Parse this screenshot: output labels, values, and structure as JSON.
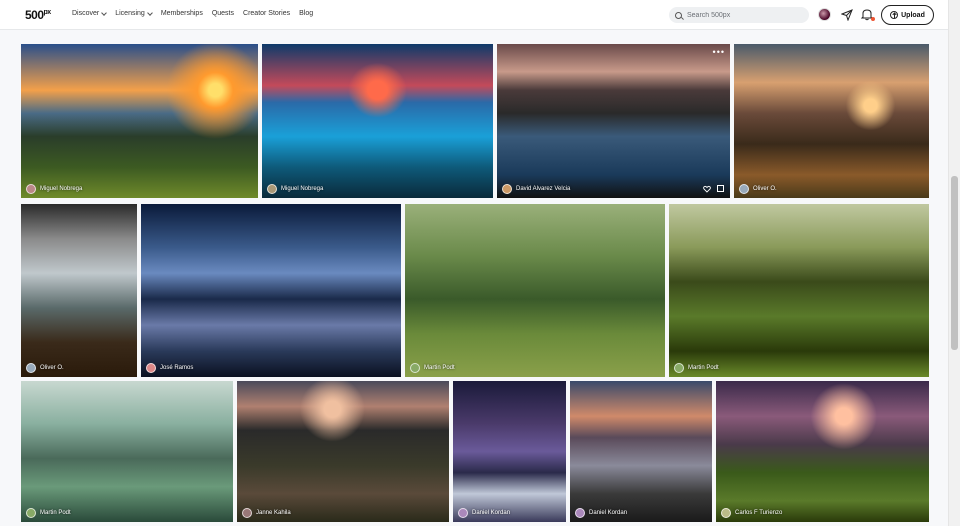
{
  "nav": {
    "logo": "500",
    "logo_sup": "px",
    "menu": [
      {
        "label": "Discover",
        "dropdown": true
      },
      {
        "label": "Licensing",
        "dropdown": true
      },
      {
        "label": "Memberships",
        "dropdown": false
      },
      {
        "label": "Quests",
        "dropdown": false
      },
      {
        "label": "Creator Stories",
        "dropdown": false
      },
      {
        "label": "Blog",
        "dropdown": false
      }
    ],
    "search_placeholder": "Search 500px",
    "upload_label": "Upload"
  },
  "photos": [
    {
      "photographer": "Miguel Nobrega",
      "scene": "cliff-sunset"
    },
    {
      "photographer": "Miguel Nobrega",
      "scene": "tidepools"
    },
    {
      "photographer": "David Alvarez Velcia",
      "scene": "sea-cliffs",
      "hovered": true
    },
    {
      "photographer": "Oliver O.",
      "scene": "coast-cliffs"
    },
    {
      "photographer": "Oliver O.",
      "scene": "fjord-vertical"
    },
    {
      "photographer": "José Ramos",
      "scene": "sea-stacks"
    },
    {
      "photographer": "Martin Podt",
      "scene": "forest-green"
    },
    {
      "photographer": "Martin Podt",
      "scene": "mossy-tree"
    },
    {
      "photographer": "Martin Podt",
      "scene": "misty-forest"
    },
    {
      "photographer": "Janne Kahila",
      "scene": "mountain-path"
    },
    {
      "photographer": "Daniel Kordan",
      "scene": "milkyway-tree"
    },
    {
      "photographer": "Daniel Kordan",
      "scene": "dead-tree"
    },
    {
      "photographer": "Carlos F Turienzo",
      "scene": "mossy-rocks"
    }
  ]
}
